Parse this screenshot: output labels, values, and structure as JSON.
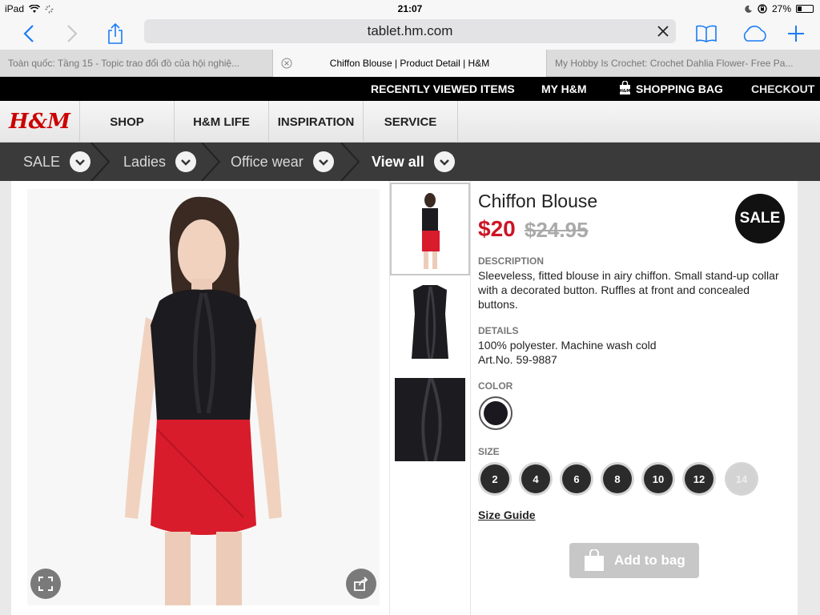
{
  "status": {
    "device": "iPad",
    "time": "21:07",
    "battery": "27%",
    "battery_fraction": 0.27
  },
  "browser": {
    "url": "tablet.hm.com",
    "tabs": [
      {
        "label": "Toàn quốc: Tầng 15 - Topic trao đổi đồ của hội nghiệ..."
      },
      {
        "label": "Chiffon Blouse | Product Detail | H&M"
      },
      {
        "label": "My Hobby Is Crochet: Crochet Dahlia Flower- Free Pa..."
      }
    ]
  },
  "userbar": {
    "recently_viewed": "RECENTLY VIEWED ITEMS",
    "my_hm": "MY H&M",
    "shopping_bag": "SHOPPING BAG",
    "checkout": "CHECKOUT"
  },
  "nav": {
    "logo": "H&M",
    "items": [
      "SHOP",
      "H&M LIFE",
      "INSPIRATION",
      "SERVICE"
    ]
  },
  "breadcrumb": [
    "SALE",
    "Ladies",
    "Office wear",
    "View all"
  ],
  "product": {
    "title": "Chiffon Blouse",
    "price": "$20",
    "old_price": "$24.95",
    "badge": "SALE",
    "description_label": "DESCRIPTION",
    "description": "Sleeveless, fitted blouse in airy chiffon. Small stand-up collar with a decorated button. Ruffles at front and concealed buttons.",
    "details_label": "DETAILS",
    "details_line1": "100% polyester. Machine wash cold",
    "details_line2": "Art.No. 59-9887",
    "color_label": "COLOR",
    "size_label": "SIZE",
    "sizes": [
      "2",
      "4",
      "6",
      "8",
      "10",
      "12",
      "14"
    ],
    "size_guide": "Size Guide",
    "add_to_bag": "Add to bag",
    "bag_icon_text": "H&M"
  },
  "colors": {
    "accent": "#1a7cf5",
    "brand_red": "#cc0000",
    "price_red": "#cc1525",
    "skirt": "#d81c2c",
    "blouse": "#1c1b1f"
  }
}
